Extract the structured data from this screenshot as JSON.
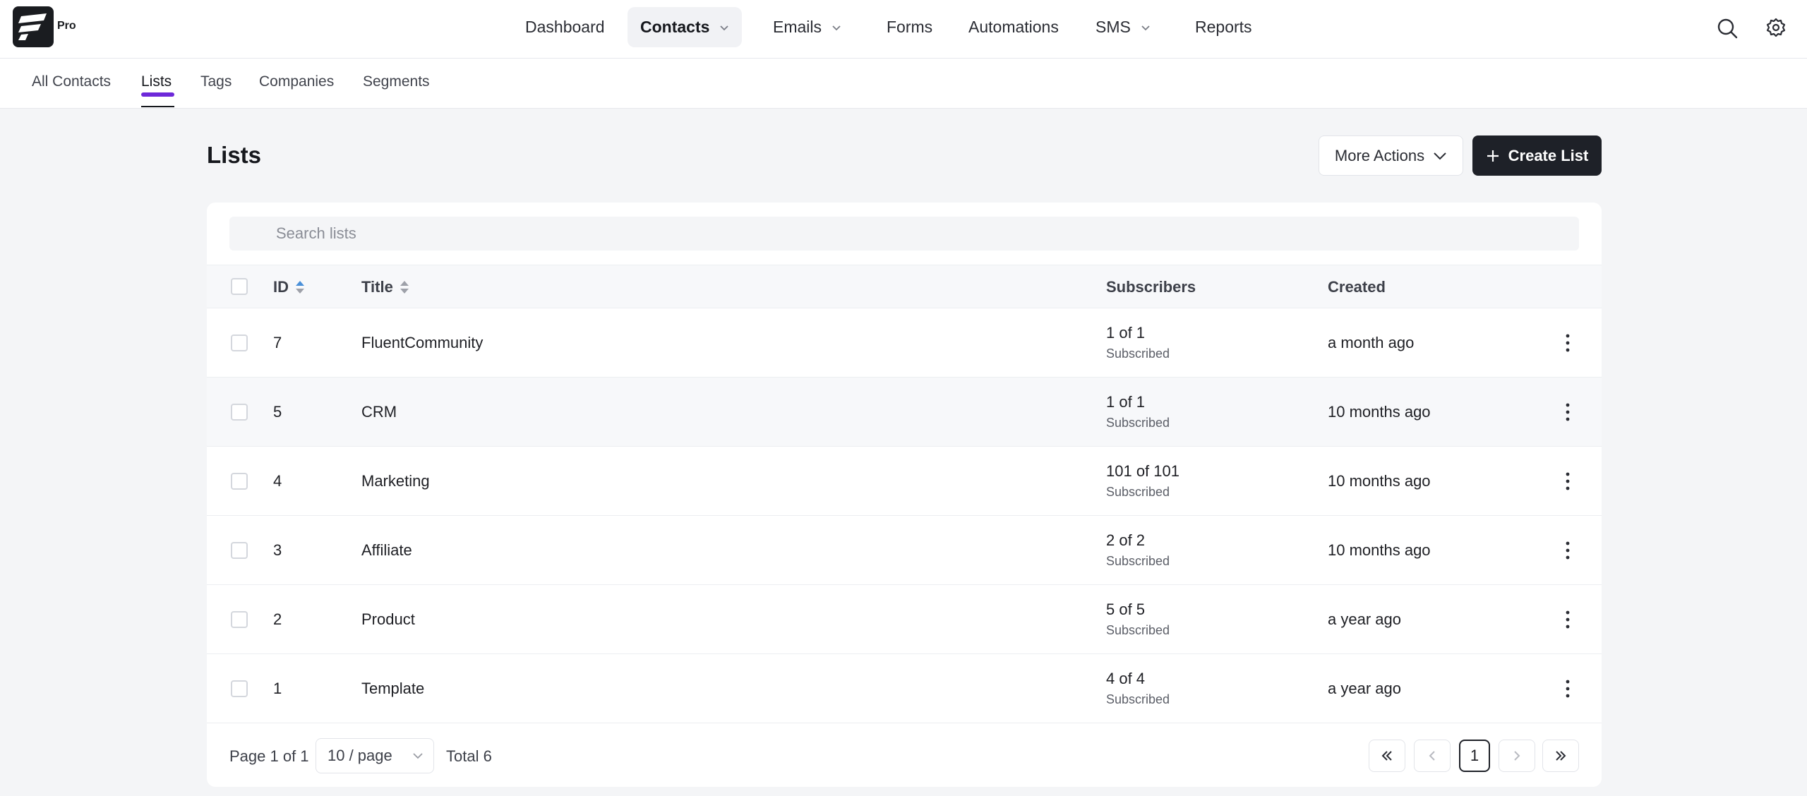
{
  "brand": {
    "badge": "Pro"
  },
  "nav": {
    "items": [
      {
        "label": "Dashboard",
        "dropdown": false,
        "active": false
      },
      {
        "label": "Contacts",
        "dropdown": true,
        "active": true
      },
      {
        "label": "Emails",
        "dropdown": true,
        "active": false
      },
      {
        "label": "Forms",
        "dropdown": false,
        "active": false
      },
      {
        "label": "Automations",
        "dropdown": false,
        "active": false
      },
      {
        "label": "SMS",
        "dropdown": true,
        "active": false
      },
      {
        "label": "Reports",
        "dropdown": false,
        "active": false
      }
    ],
    "icons": [
      "search-icon",
      "gear-icon"
    ]
  },
  "subnav": {
    "items": [
      "All Contacts",
      "Lists",
      "Tags",
      "Companies",
      "Segments"
    ],
    "active": "Lists"
  },
  "page": {
    "title": "Lists",
    "more_actions_label": "More Actions",
    "create_label": "Create List"
  },
  "search": {
    "placeholder": "Search lists",
    "value": ""
  },
  "table": {
    "headers": {
      "id": "ID",
      "title": "Title",
      "subscribers": "Subscribers",
      "created": "Created"
    },
    "rows": [
      {
        "id": "7",
        "title": "FluentCommunity",
        "subscribers": "1 of 1",
        "status": "Subscribed",
        "created": "a month ago"
      },
      {
        "id": "5",
        "title": "CRM",
        "subscribers": "1 of 1",
        "status": "Subscribed",
        "created": "10 months ago"
      },
      {
        "id": "4",
        "title": "Marketing",
        "subscribers": "101 of 101",
        "status": "Subscribed",
        "created": "10 months ago"
      },
      {
        "id": "3",
        "title": "Affiliate",
        "subscribers": "2 of 2",
        "status": "Subscribed",
        "created": "10 months ago"
      },
      {
        "id": "2",
        "title": "Product",
        "subscribers": "5 of 5",
        "status": "Subscribed",
        "created": "a year ago"
      },
      {
        "id": "1",
        "title": "Template",
        "subscribers": "4 of 4",
        "status": "Subscribed",
        "created": "a year ago"
      }
    ]
  },
  "pagination": {
    "page_text": "Page 1 of 1",
    "per_page": "10 / page",
    "total_text": "Total 6",
    "current_page": "1"
  },
  "colors": {
    "accent": "#6d28d9",
    "primary_button": "#1e2128",
    "sort_active": "#4a90d9"
  }
}
